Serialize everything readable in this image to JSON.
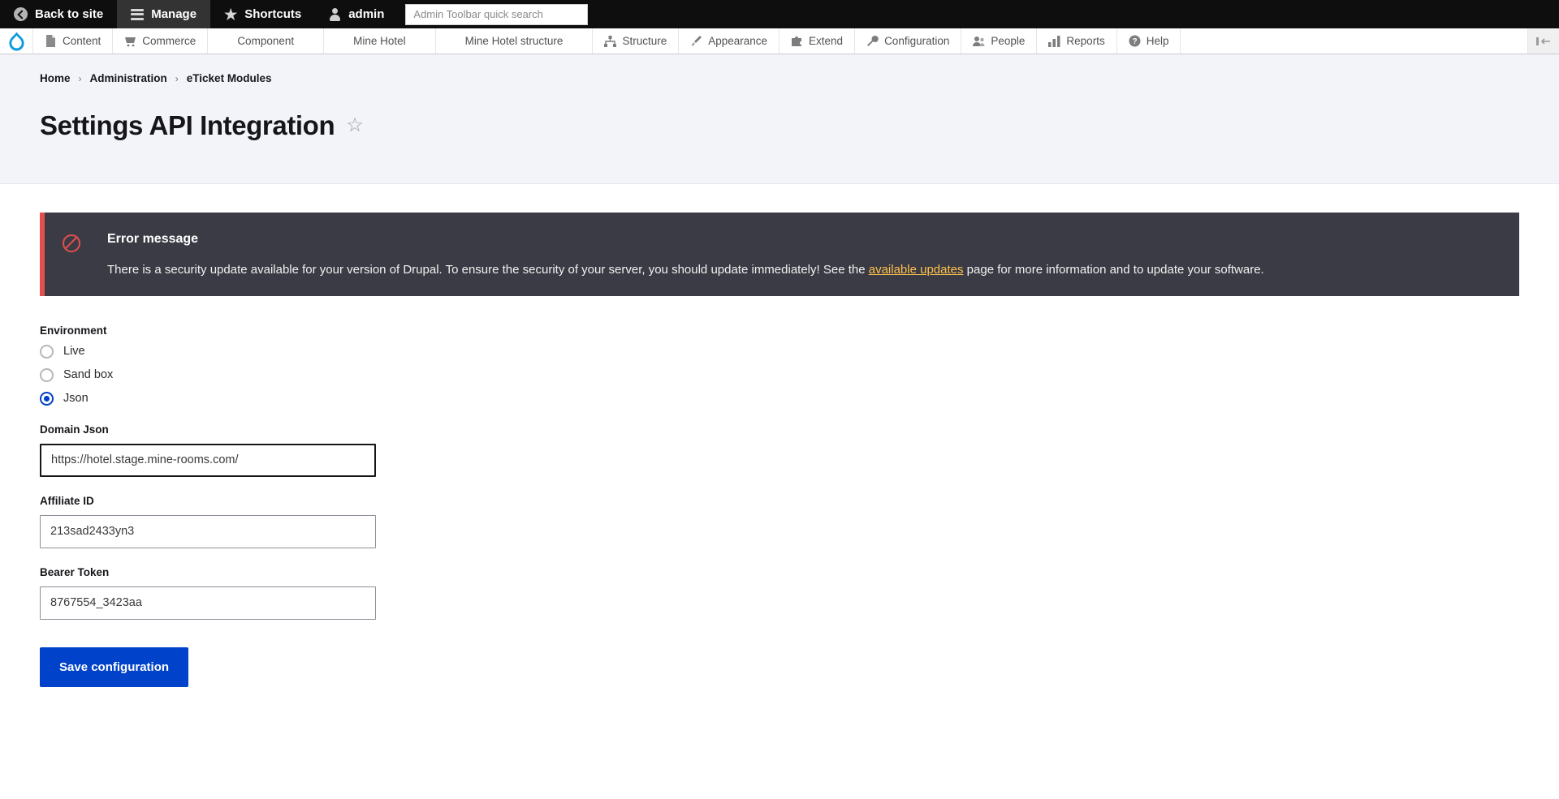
{
  "admin_toolbar": {
    "items": [
      {
        "label": "Back to site",
        "icon": "back-arrow-icon",
        "active": false
      },
      {
        "label": "Manage",
        "icon": "hamburger-icon",
        "active": true
      },
      {
        "label": "Shortcuts",
        "icon": "star-icon",
        "active": false
      },
      {
        "label": "admin",
        "icon": "user-icon",
        "active": false
      }
    ],
    "search_placeholder": "Admin Toolbar quick search",
    "search_value": ""
  },
  "menu_bar": {
    "logo_name": "drupal-logo-icon",
    "items": [
      {
        "label": "Content",
        "icon": "page-icon"
      },
      {
        "label": "Commerce",
        "icon": "cart-icon"
      },
      {
        "label": "Component",
        "icon": ""
      },
      {
        "label": "Mine Hotel",
        "icon": ""
      },
      {
        "label": "Mine Hotel structure",
        "icon": ""
      },
      {
        "label": "Structure",
        "icon": "structure-icon"
      },
      {
        "label": "Appearance",
        "icon": "brush-icon"
      },
      {
        "label": "Extend",
        "icon": "puzzle-icon"
      },
      {
        "label": "Configuration",
        "icon": "wrench-icon"
      },
      {
        "label": "People",
        "icon": "people-icon"
      },
      {
        "label": "Reports",
        "icon": "bar-chart-icon"
      },
      {
        "label": "Help",
        "icon": "question-icon"
      }
    ],
    "orientation_toggle": "toolbar-orientation-icon"
  },
  "breadcrumb": [
    {
      "label": "Home"
    },
    {
      "label": "Administration"
    },
    {
      "label": "eTicket Modules"
    }
  ],
  "page": {
    "title": "Settings API Integration",
    "bookmark_icon": "star-outline-icon"
  },
  "error_message": {
    "title": "Error message",
    "icon": "error-circle-icon",
    "text_before": "There is a security update available for your version of Drupal. To ensure the security of your server, you should update immediately! See the ",
    "link_label": "available updates",
    "text_after": " page for more information and to update your software."
  },
  "form": {
    "environment": {
      "label": "Environment",
      "options": [
        {
          "label": "Live",
          "checked": false
        },
        {
          "label": "Sand box",
          "checked": false
        },
        {
          "label": "Json",
          "checked": true
        }
      ]
    },
    "domain_json": {
      "label": "Domain Json",
      "value": "https://hotel.stage.mine-rooms.com/",
      "placeholder": ""
    },
    "affiliate_id": {
      "label": "Affiliate ID",
      "value": "213sad2433yn3",
      "placeholder": ""
    },
    "bearer_token": {
      "label": "Bearer Token",
      "value": "8767554_3423aa",
      "placeholder": ""
    },
    "save_label": "Save configuration"
  },
  "colors": {
    "accent": "#0042c9",
    "error": "#e34f4f",
    "error_bg": "#3b3b45",
    "link": "#ffc14d",
    "page_head_bg": "#f3f4f9"
  }
}
